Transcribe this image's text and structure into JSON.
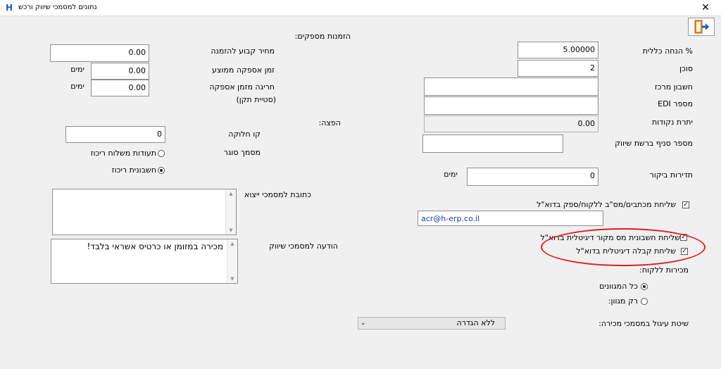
{
  "window": {
    "title": "נתונים למסמכי שיווק ורכש",
    "app_icon": "H",
    "close": "✕"
  },
  "toolbar": {
    "exit_icon": "exit-door-icon"
  },
  "right": {
    "total_discount_label": "% הנחה כללית",
    "total_discount_value": "5.00000",
    "agent_label": "סוכן",
    "agent_value": "2",
    "central_account_label": "חשבון מרכז",
    "central_account_value": "",
    "edi_label": "מספר EDI",
    "edi_value": "",
    "points_balance_label": "יתרת נקודות",
    "points_balance_value": "0.00",
    "distribution_label": "הפצה:",
    "branch_label": "מספר סניף ברשת שיווק",
    "branch_value": "",
    "visit_freq_label": "תדירות ביקור",
    "visit_freq_value": "0",
    "visit_freq_unit": "ימים",
    "send_docs_label": "שליחת מכתבים/מס\"ב  ללקוח/ספק  בדוא\"ל",
    "send_docs_checked": true,
    "email_value": "acr@h-erp.co.il",
    "send_digital_invoice_label": "שליחת חשבונית מס מקור דיגיטלית בדוא\"ל",
    "send_digital_invoice_checked": true,
    "send_digital_receipt_label": "שליחת קבלה דיגיטלית בדוא\"ל",
    "send_digital_receipt_checked": true,
    "sales_label": "מכירות ללקוח:",
    "sales_all_label": "כל המגוונים",
    "sales_all_selected": true,
    "sales_only_label": "רק מגוון:",
    "sales_only_selected": false,
    "rounding_label": "שיטת עיגול במסמכי מכירה:",
    "rounding_value": "ללא הגדרה"
  },
  "left": {
    "supplier_orders_label": "הזמנות מספקים:",
    "fixed_price_label": "מחיר קבוע להזמנה",
    "fixed_price_value": "0.00",
    "avg_supply_label": "זמן אספקה ממוצע",
    "avg_supply_value": "0.00",
    "avg_supply_unit": "ימים",
    "supply_deviation_label": "חריגה מזמן אספקה",
    "supply_deviation_sub": "(סטיית תקן)",
    "supply_deviation_value": "0.00",
    "supply_deviation_unit": "ימים",
    "division_line_label": "קו חלוקה",
    "division_line_value": "0",
    "closing_doc_label": "מסמך סוגר",
    "closing_option1_label": "תעודות משלוח ריכוז",
    "closing_option1_selected": false,
    "closing_option2_label": "חשבונית ריכוז",
    "closing_option2_selected": true,
    "export_address_label": "כתובת למסמכי ייצוא",
    "export_address_value": "",
    "marketing_msg_label": "הודעה למסמכי שיווק",
    "marketing_msg_value": "מכירה במזומן או כרטיס אשראי בלבד!"
  }
}
